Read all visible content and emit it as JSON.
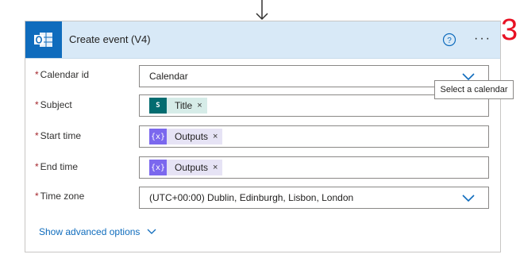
{
  "action": {
    "title": "Create event (V4)",
    "step_number": "3",
    "more_label": "···"
  },
  "icons": {
    "app": "outlook-icon",
    "help": "help-circle-icon",
    "more": "more-horizontal-icon",
    "chevron": "chevron-down-icon",
    "flow_arrow": "arrow-down-icon"
  },
  "fields": {
    "calendar_id": {
      "label": "Calendar id",
      "required_mark": "*",
      "value": "Calendar"
    },
    "subject": {
      "label": "Subject",
      "required_mark": "*",
      "token": {
        "label": "Title",
        "icon": "sharepoint-icon",
        "close": "×"
      }
    },
    "start_time": {
      "label": "Start time",
      "required_mark": "*",
      "token": {
        "label": "Outputs",
        "icon": "expression-icon",
        "glyph": "{x}",
        "close": "×"
      }
    },
    "end_time": {
      "label": "End time",
      "required_mark": "*",
      "token": {
        "label": "Outputs",
        "icon": "expression-icon",
        "glyph": "{x}",
        "close": "×"
      }
    },
    "time_zone": {
      "label": "Time zone",
      "required_mark": "*",
      "value": "(UTC+00:00) Dublin, Edinburgh, Lisbon, London"
    }
  },
  "advanced_options": {
    "label": "Show advanced options"
  },
  "tooltip": {
    "text": "Select a calendar"
  },
  "colors": {
    "header_bg": "#d8e9f7",
    "accent_blue": "#0f6cbd",
    "required_red": "#a4262c",
    "step_red": "#e81123",
    "expression_purple": "#7b68ee",
    "sharepoint_teal": "#036c70"
  }
}
